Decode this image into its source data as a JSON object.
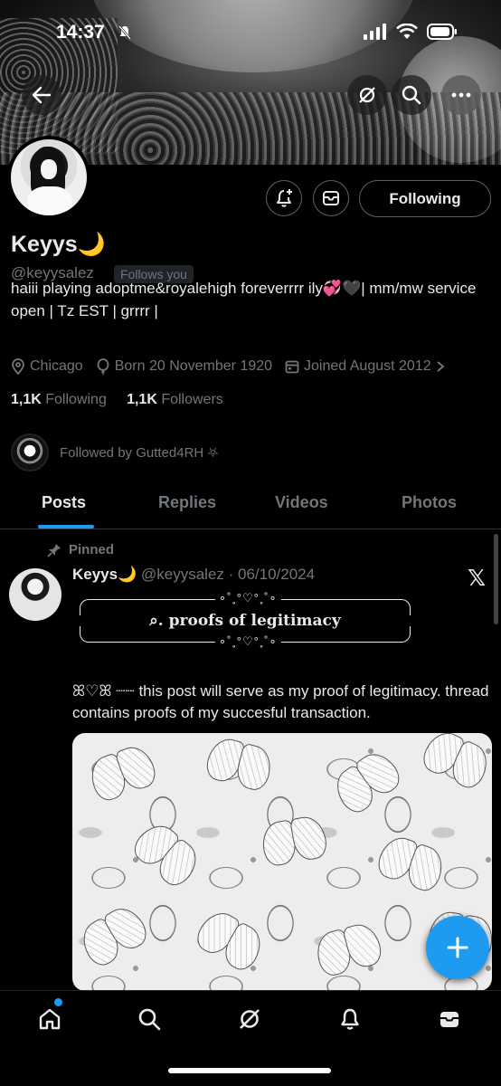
{
  "status_bar": {
    "time": "14:37"
  },
  "profile": {
    "display_name": "Keyys🌙",
    "handle": "@keyysalez",
    "follows_you": "Follows you",
    "bio": "haiii playing adoptme&royalehigh foreverrrr ily💞🖤| mm/mw service open | Tz EST | grrrr |",
    "location": "Chicago",
    "born": "Born 20 November 1920",
    "joined": "Joined August 2012",
    "following_count": "1,1K",
    "following_label": "Following",
    "followers_count": "1,1K",
    "followers_label": "Followers",
    "followed_by": "Followed by Gutted4RH ⛧",
    "follow_button": "Following"
  },
  "tabs": [
    {
      "label": "Posts",
      "active": true
    },
    {
      "label": "Replies",
      "active": false
    },
    {
      "label": "Videos",
      "active": false
    },
    {
      "label": "Photos",
      "active": false
    }
  ],
  "pinned_post": {
    "pinned_label": "Pinned",
    "author": "Keyys🌙",
    "handle_date": "@keyysalez · 06/10/2024",
    "header_title": "⌕. proofs of legitimacy",
    "ornament_top": "∘˚˳°♡°˳˚∘",
    "ornament_bottom": "∘˚˳°♡°˳˚∘",
    "text": "ꕤ♡ꕤ ┈┈ this post will serve as my proof of legitimacy. thread contains proofs of my succesful transaction."
  },
  "colors": {
    "accent": "#1d9bf0",
    "background": "#000000",
    "text_primary": "#e7e9ea",
    "text_secondary": "#71767b"
  }
}
